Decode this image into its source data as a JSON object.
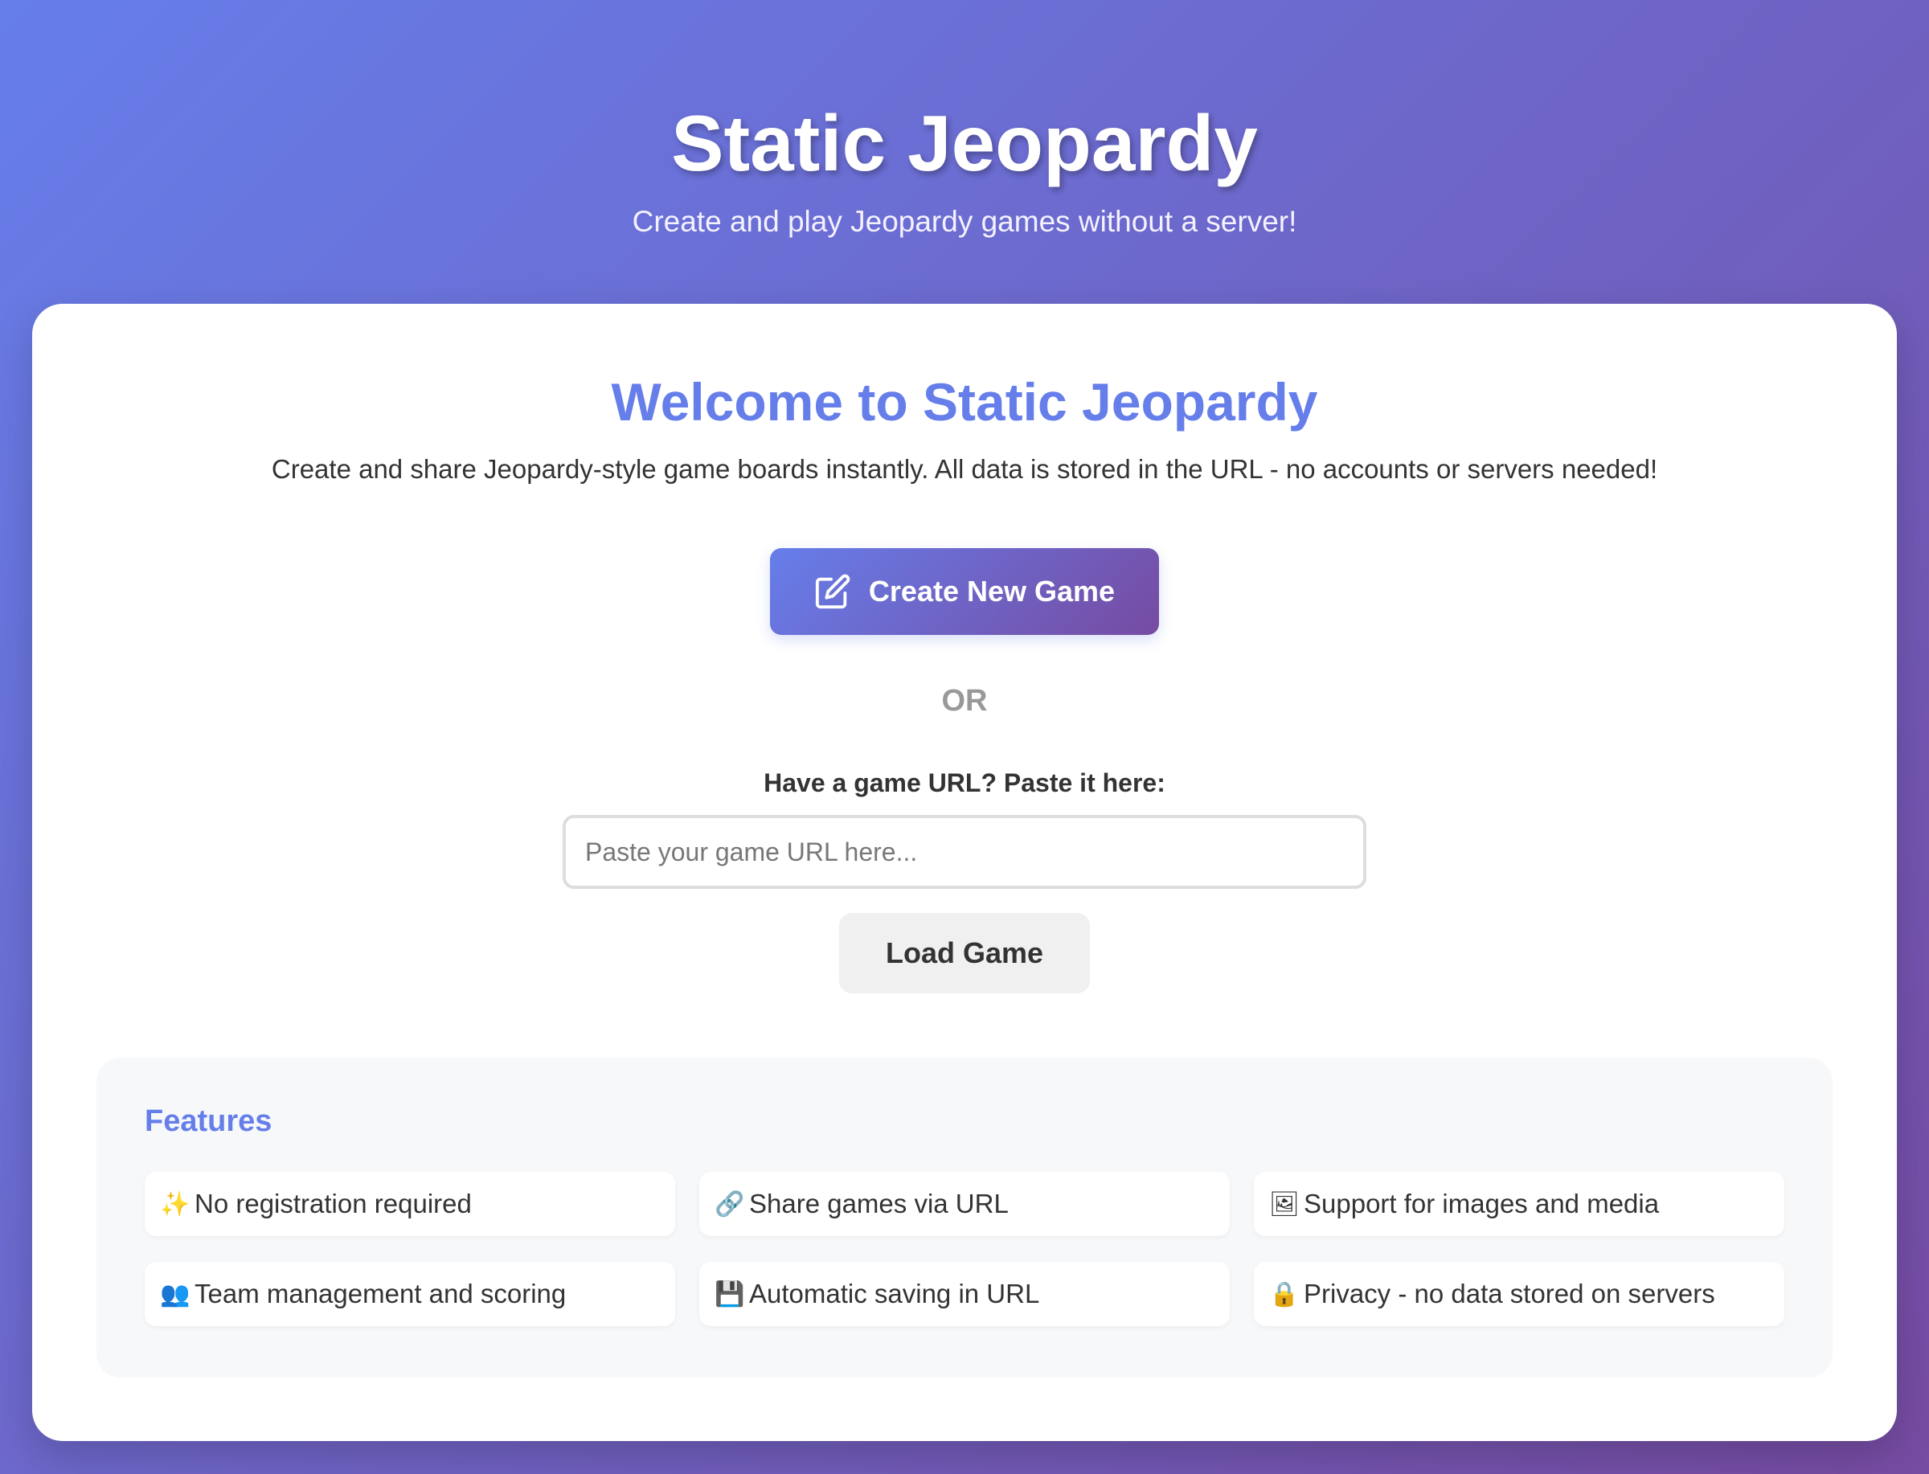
{
  "header": {
    "title": "Static Jeopardy",
    "subtitle": "Create and play Jeopardy games without a server!"
  },
  "welcome": {
    "title": "Welcome to Static Jeopardy",
    "description": "Create and share Jeopardy-style game boards instantly. All data is stored in the URL - no accounts or servers needed!"
  },
  "create_button": {
    "label": "Create New Game",
    "icon": "edit-icon"
  },
  "or_text": "OR",
  "load": {
    "label": "Have a game URL? Paste it here:",
    "input_placeholder": "Paste your game URL here...",
    "input_value": "",
    "button_label": "Load Game"
  },
  "features": {
    "title": "Features",
    "items": [
      {
        "icon": "✨",
        "icon_name": "sparkles-icon",
        "text": "No registration required"
      },
      {
        "icon": "🔗",
        "icon_name": "link-icon",
        "text": "Share games via URL"
      },
      {
        "icon": "🖼",
        "icon_name": "picture-icon",
        "text": "Support for images and media"
      },
      {
        "icon": "👥",
        "icon_name": "people-icon",
        "text": "Team management and scoring"
      },
      {
        "icon": "💾",
        "icon_name": "floppy-disk-icon",
        "text": "Automatic saving in URL"
      },
      {
        "icon": "🔒",
        "icon_name": "lock-icon",
        "text": "Privacy - no data stored on servers"
      }
    ]
  },
  "colors": {
    "gradient_start": "#667eea",
    "gradient_end": "#764ba2",
    "accent": "#667eea"
  }
}
